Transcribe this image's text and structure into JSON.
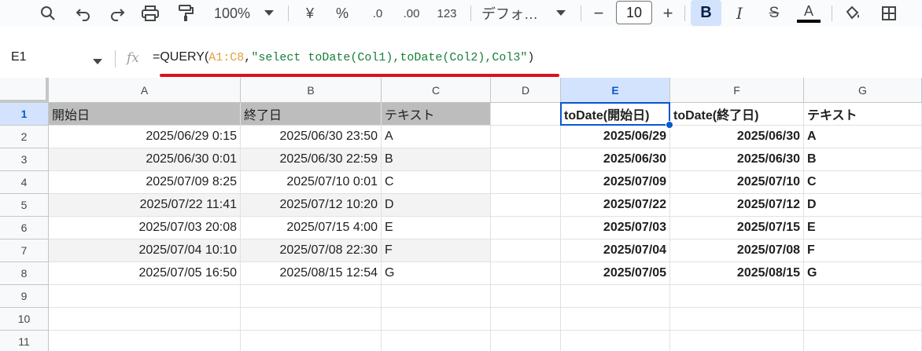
{
  "toolbar": {
    "zoom": "100%",
    "currency": "¥",
    "percent": "%",
    "dec_decrease": ".0",
    "dec_increase": ".00",
    "number_format": "123",
    "font": "デフォ…",
    "minus": "−",
    "font_size": "10",
    "plus": "+",
    "bold": "B",
    "italic": "I",
    "strike": "S",
    "text_color": "A",
    "icons": [
      "search-icon",
      "undo-icon",
      "redo-icon",
      "print-icon",
      "paint-format-icon",
      "chevron-down-icon",
      "fill-color-icon",
      "borders-icon"
    ]
  },
  "formula_bar": {
    "name_box": "E1",
    "fx": "fx",
    "formula_prefix": "=QUERY(",
    "formula_ref": "A1:C8",
    "formula_sep": ",",
    "formula_string": "\"select toDate(Col1),toDate(Col2),Col3\"",
    "formula_suffix": ")"
  },
  "sheet": {
    "columns": [
      "A",
      "B",
      "C",
      "D",
      "E",
      "F",
      "G"
    ],
    "rows": [
      "1",
      "2",
      "3",
      "4",
      "5",
      "6",
      "7",
      "8",
      "9",
      "10",
      "11"
    ],
    "selected_column": "E",
    "selected_row": "1",
    "source_headers": [
      "開始日",
      "終了日",
      "テキスト"
    ],
    "source_rows": [
      [
        "2025/06/29 0:15",
        "2025/06/30 23:50",
        "A"
      ],
      [
        "2025/06/30 0:01",
        "2025/06/30 22:59",
        "B"
      ],
      [
        "2025/07/09 8:25",
        "2025/07/10 0:01",
        "C"
      ],
      [
        "2025/07/22 11:41",
        "2025/07/12 10:20",
        "D"
      ],
      [
        "2025/07/03 20:08",
        "2025/07/15 4:00",
        "E"
      ],
      [
        "2025/07/04 10:10",
        "2025/07/08 22:30",
        "F"
      ],
      [
        "2025/07/05 16:50",
        "2025/08/15 12:54",
        "G"
      ]
    ],
    "result_headers": [
      "toDate(開始日)",
      "toDate(終了日)",
      "テキスト"
    ],
    "result_rows": [
      [
        "2025/06/29",
        "2025/06/30",
        "A"
      ],
      [
        "2025/06/30",
        "2025/06/30",
        "B"
      ],
      [
        "2025/07/09",
        "2025/07/10",
        "C"
      ],
      [
        "2025/07/22",
        "2025/07/12",
        "D"
      ],
      [
        "2025/07/03",
        "2025/07/15",
        "E"
      ],
      [
        "2025/07/04",
        "2025/07/08",
        "F"
      ],
      [
        "2025/07/05",
        "2025/08/15",
        "G"
      ]
    ]
  },
  "colors": {
    "accent": "#0b57d0",
    "selected_header_bg": "#d3e3fd",
    "header_row_bg": "#bdbdbd",
    "band_bg": "#f3f3f3",
    "formula_ref": "#e3a03b",
    "formula_string": "#188038",
    "underline": "#d9131c"
  }
}
